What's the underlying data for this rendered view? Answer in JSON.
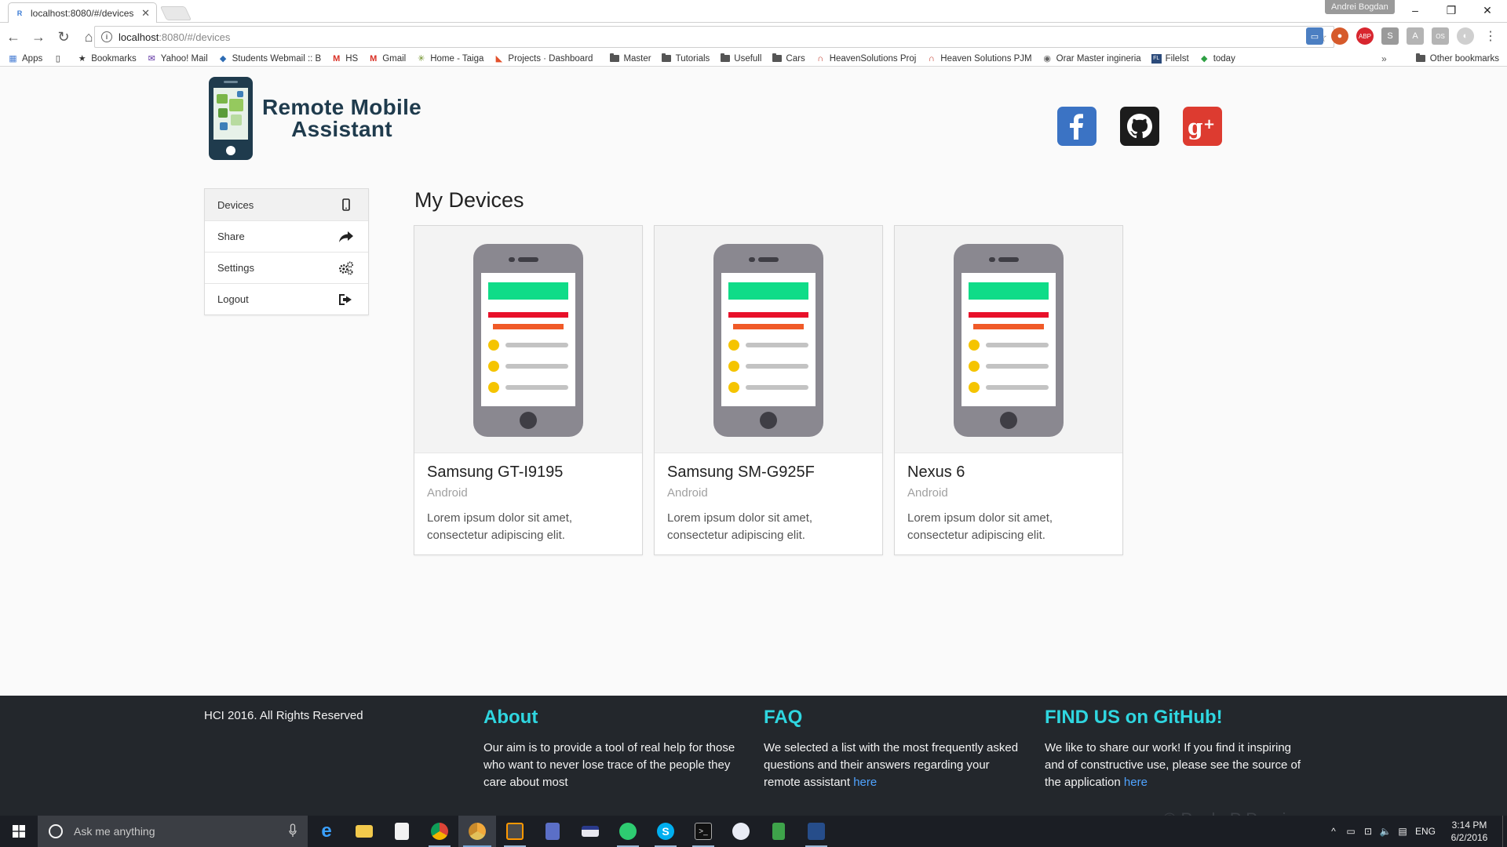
{
  "browser": {
    "tab_title": "localhost:8080/#/devices",
    "profile_name": "Andrei Bogdan",
    "url_host": "localhost",
    "url_path": ":8080/#/devices",
    "bookmarks": [
      {
        "label": "Apps",
        "icon": "apps-grid-icon"
      },
      {
        "label": "",
        "icon": "page-icon"
      },
      {
        "label": "Bookmarks",
        "icon": "star-icon"
      },
      {
        "label": "Yahoo! Mail",
        "icon": "mail-icon"
      },
      {
        "label": "Students Webmail :: B",
        "icon": "webmail-icon"
      },
      {
        "label": "HS",
        "icon": "gmail-icon"
      },
      {
        "label": "Gmail",
        "icon": "gmail-icon"
      },
      {
        "label": "Home - Taiga",
        "icon": "taiga-icon"
      },
      {
        "label": "Projects · Dashboard",
        "icon": "gitlab-icon"
      },
      {
        "label": "Master",
        "icon": "folder-icon"
      },
      {
        "label": "Tutorials",
        "icon": "folder-icon"
      },
      {
        "label": "Usefull",
        "icon": "folder-icon"
      },
      {
        "label": "Cars",
        "icon": "folder-icon"
      },
      {
        "label": "HeavenSolutions Proj",
        "icon": "heaven-icon"
      },
      {
        "label": "Heaven Solutions PJM",
        "icon": "heaven-icon"
      },
      {
        "label": "Orar Master ingineria",
        "icon": "globe-icon"
      },
      {
        "label": "Filelst",
        "icon": "filelist-icon"
      },
      {
        "label": "today",
        "icon": "diamond-icon"
      }
    ],
    "more_bookmarks": "»",
    "other_bookmarks": "Other bookmarks"
  },
  "header": {
    "logo_line1": "Remote Mobile",
    "logo_line2": "Assistant"
  },
  "sidebar": {
    "items": [
      {
        "label": "Devices",
        "icon": "mobile-phone-icon"
      },
      {
        "label": "Share",
        "icon": "share-arrow-icon"
      },
      {
        "label": "Settings",
        "icon": "gears-icon"
      },
      {
        "label": "Logout",
        "icon": "sign-out-icon"
      }
    ]
  },
  "main": {
    "title": "My Devices",
    "devices": [
      {
        "name": "Samsung GT-I9195",
        "os": "Android",
        "description": "Lorem ipsum dolor sit amet, consectetur adipiscing elit."
      },
      {
        "name": "Samsung SM-G925F",
        "os": "Android",
        "description": "Lorem ipsum dolor sit amet, consectetur adipiscing elit."
      },
      {
        "name": "Nexus 6",
        "os": "Android",
        "description": "Lorem ipsum dolor sit amet, consectetur adipiscing elit."
      }
    ]
  },
  "footer": {
    "copyright": "HCI 2016. All Rights Reserved",
    "about_title": "About",
    "about_text": "Our aim is to provide a tool of real help for those who want to never lose trace of the people they care about most",
    "faq_title": "FAQ",
    "faq_text": "We selected a list with the most frequently asked questions and their answers regarding your remote assistant",
    "faq_link": "here",
    "github_title": "FIND US on GitHub!",
    "github_text": "We like to share our work! If you find it inspiring and of constructive use, please see the source of the application",
    "github_link": "here",
    "watermark": "©  Paulo P Pereira"
  },
  "taskbar": {
    "search_placeholder": "Ask me anything",
    "language": "ENG",
    "time": "3:14 PM",
    "date": "6/2/2016"
  },
  "colors": {
    "accent": "#2fd6e0",
    "link": "#4fa3ff",
    "footer_bg": "#23272c",
    "facebook": "#3b73c4",
    "github": "#1c1c1c",
    "googleplus": "#dd3b30"
  }
}
